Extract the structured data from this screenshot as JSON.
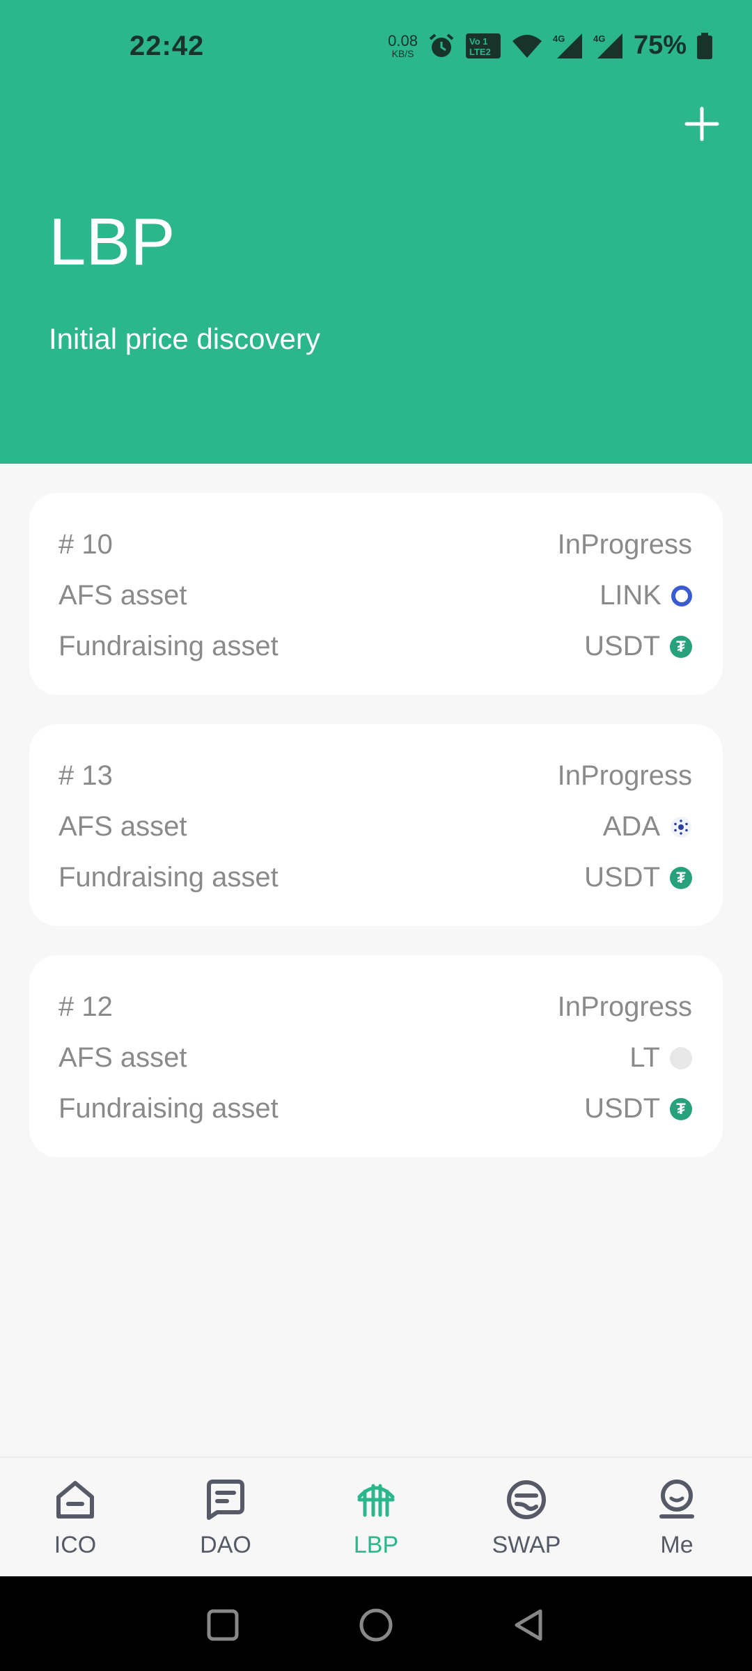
{
  "status_bar": {
    "time": "22:42",
    "net_speed_value": "0.08",
    "net_speed_unit": "KB/S",
    "battery_percent": "75%"
  },
  "header": {
    "title": "LBP",
    "subtitle": "Initial price discovery",
    "background_color": "#2cb68c"
  },
  "cards": [
    {
      "id": "# 10",
      "status": "InProgress",
      "afs_label": "AFS asset",
      "afs_value": "LINK",
      "afs_icon": "link-coin-icon",
      "fund_label": "Fundraising asset",
      "fund_value": "USDT",
      "fund_icon": "usdt-coin-icon"
    },
    {
      "id": "# 13",
      "status": "InProgress",
      "afs_label": "AFS asset",
      "afs_value": "ADA",
      "afs_icon": "ada-coin-icon",
      "fund_label": "Fundraising asset",
      "fund_value": "USDT",
      "fund_icon": "usdt-coin-icon"
    },
    {
      "id": "# 12",
      "status": "InProgress",
      "afs_label": "AFS asset",
      "afs_value": "LT",
      "afs_icon": "placeholder-coin-icon",
      "fund_label": "Fundraising asset",
      "fund_value": "USDT",
      "fund_icon": "usdt-coin-icon"
    }
  ],
  "bottom_nav": {
    "items": [
      {
        "label": "ICO",
        "icon": "ico-icon"
      },
      {
        "label": "DAO",
        "icon": "dao-icon"
      },
      {
        "label": "LBP",
        "icon": "lbp-icon",
        "active": true
      },
      {
        "label": "SWAP",
        "icon": "swap-icon"
      },
      {
        "label": "Me",
        "icon": "me-icon"
      }
    ],
    "active_color": "#2cb68c",
    "inactive_color": "#555a66"
  }
}
